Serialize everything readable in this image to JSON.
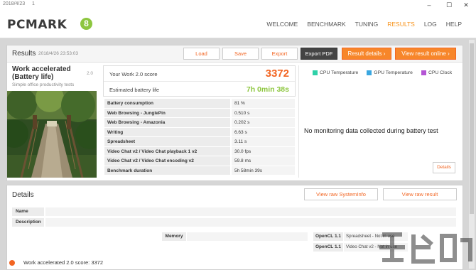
{
  "titlebar": {
    "date": "2018/4/23",
    "num": "1"
  },
  "header": {
    "logo": "PCMARK",
    "logo_badge": "8",
    "nav": [
      "WELCOME",
      "BENCHMARK",
      "TUNING",
      "RESULTS",
      "LOG",
      "HELP"
    ],
    "active": "RESULTS"
  },
  "results": {
    "title": "Results",
    "date": "2018/4/26 23:53:03",
    "buttons": {
      "load": "Load",
      "save": "Save",
      "export": "Export",
      "export_pdf": "Export PDF",
      "result_details": "Result details",
      "view_online": "View result online"
    },
    "test_title": "Work accelerated (Battery life)",
    "test_version": "2.0",
    "test_sub": "Simple office productivity tests",
    "score_label": "Your Work 2.0 score",
    "score_value": "3372",
    "battery_label": "Estimated battery life",
    "battery_value": "7h 0min 38s",
    "metrics": [
      {
        "name": "Battery consumption",
        "value": "81 %"
      },
      {
        "name": "Web Browsing - JunglePin",
        "value": "0.510 s"
      },
      {
        "name": "Web Browsing - Amazonia",
        "value": "0.202 s"
      },
      {
        "name": "Writing",
        "value": "6.63 s"
      },
      {
        "name": "Spreadsheet",
        "value": "3.11 s"
      },
      {
        "name": "Video Chat v2 / Video Chat playback 1 v2",
        "value": "30.0 fps"
      },
      {
        "name": "Video Chat v2 / Video Chat encoding v2",
        "value": "59.8 ms"
      },
      {
        "name": "Benchmark duration",
        "value": "5h 58min 39s"
      }
    ],
    "legend": [
      {
        "label": "CPU Temperature",
        "color": "#2ed1a8"
      },
      {
        "label": "GPU Temperature",
        "color": "#3aa7e0"
      },
      {
        "label": "CPU Clock",
        "color": "#b455d4"
      }
    ],
    "no_monitoring": "No monitoring data collected during battery test",
    "details_button": "Details"
  },
  "details": {
    "title": "Details",
    "view_systeminfo": "View raw SystemInfo",
    "view_result": "View raw result",
    "name_label": "Name",
    "description_label": "Description",
    "memory_label": "Memory",
    "opencl": [
      {
        "label": "OpenCL 1.1",
        "value": "Spreadsheet - Not in use"
      },
      {
        "label": "OpenCL 1.1",
        "value": "Video Chat v2 - Not in use"
      }
    ],
    "footer": "Work accelerated 2.0 score: 3372"
  }
}
